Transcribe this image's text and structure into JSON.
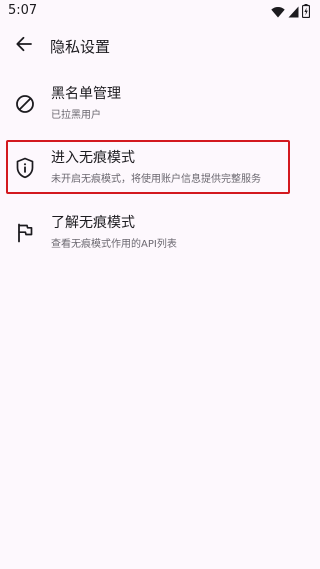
{
  "status_bar": {
    "time": "5:07",
    "icons": [
      "wifi-icon",
      "signal-icon",
      "battery-icon"
    ]
  },
  "header": {
    "title": "隐私设置",
    "back_icon": "arrow-left-icon"
  },
  "settings": {
    "items": [
      {
        "icon": "block-icon",
        "title": "黑名单管理",
        "subtitle": "已拉黑用户"
      },
      {
        "icon": "shield-info-icon",
        "title": "进入无痕模式",
        "subtitle": "未开启无痕模式，将使用账户信息提供完整服务"
      },
      {
        "icon": "flag-icon",
        "title": "了解无痕模式",
        "subtitle": "查看无痕模式作用的API列表"
      }
    ]
  },
  "colors": {
    "background": "#fdf8fd",
    "highlight_border": "#d3191f",
    "primary_text": "#1c1b1f",
    "secondary_text": "#6b6870"
  }
}
